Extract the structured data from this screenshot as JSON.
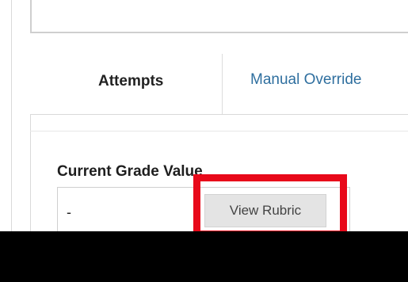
{
  "tabs": {
    "attempts_label": "Attempts",
    "manual_override_label": "Manual Override"
  },
  "grade": {
    "label": "Current Grade Value",
    "value": "-"
  },
  "rubric_button": {
    "label": "View Rubric"
  },
  "colors": {
    "link": "#2f6f9f",
    "highlight": "#e8091a",
    "redaction": "#000000"
  }
}
